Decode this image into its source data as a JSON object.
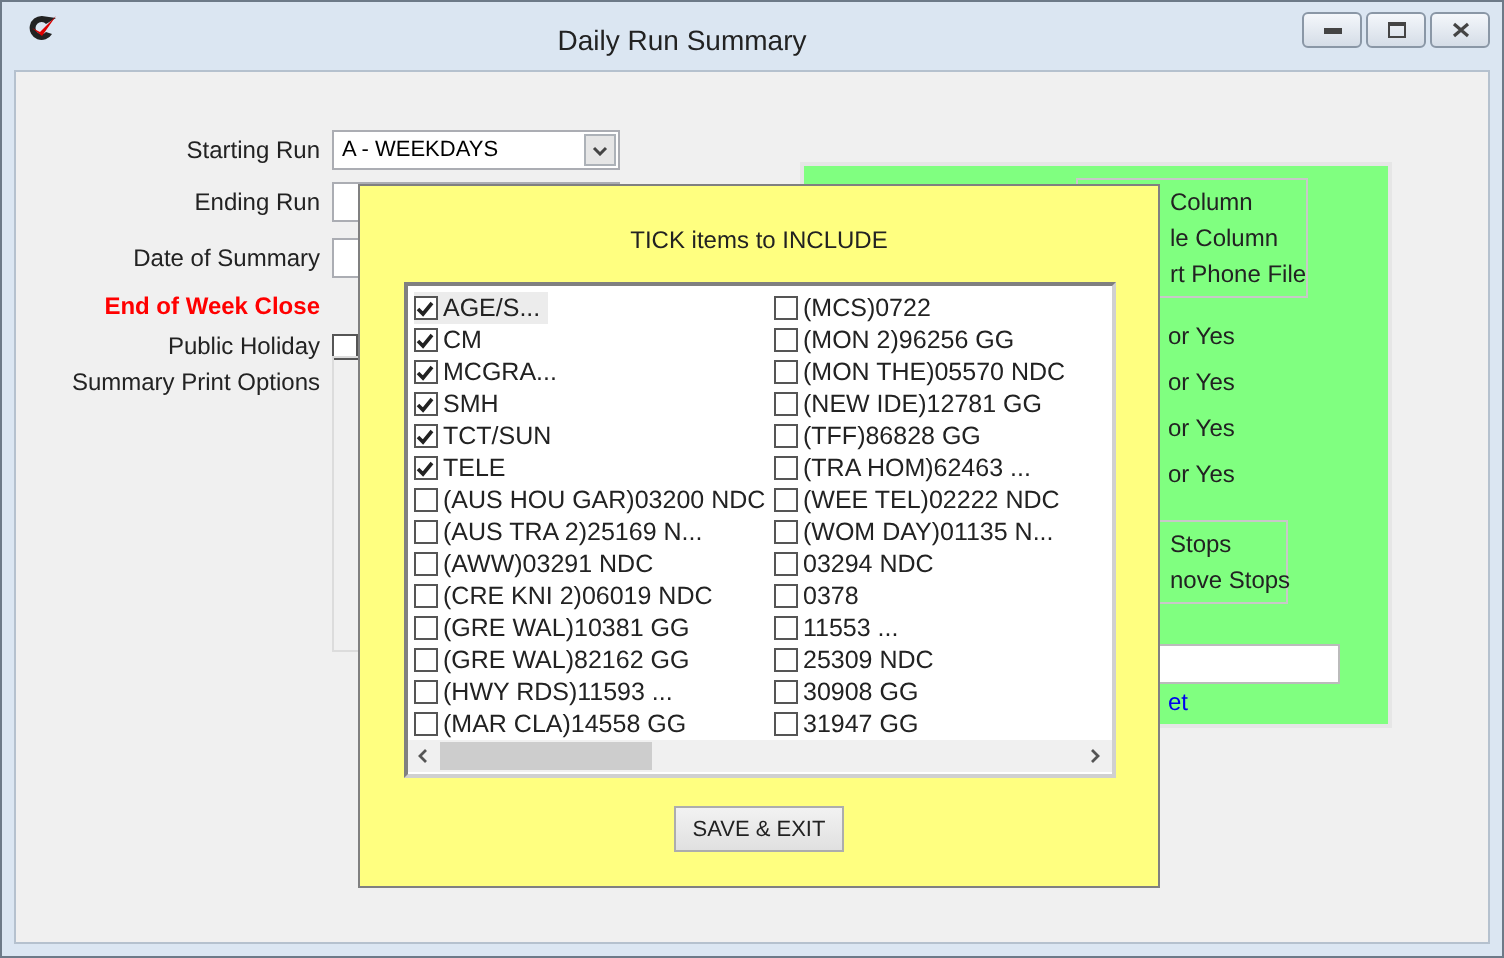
{
  "window": {
    "title": "Daily Run Summary"
  },
  "form": {
    "fields": [
      {
        "label": "Starting Run",
        "kind": "select",
        "value": "A  - WEEKDAYS"
      },
      {
        "label": "Ending Run",
        "kind": "select"
      },
      {
        "label": "Date of Summary",
        "kind": "text"
      },
      {
        "label": "End of Week Close",
        "kind": "warning"
      },
      {
        "label": "Public Holiday",
        "kind": "checkbox",
        "checked": false
      },
      {
        "label": "Summary Print Options",
        "kind": "panel"
      }
    ]
  },
  "options_panel": {
    "group_1": [
      "Column",
      "le Column",
      "rt Phone File"
    ],
    "toggles": [
      "or Yes",
      "or Yes",
      "or Yes",
      "or Yes"
    ],
    "group_2": [
      "Stops",
      "nove Stops"
    ],
    "link": "et"
  },
  "dialog": {
    "title": "TICK items to INCLUDE",
    "items": [
      {
        "label": "AGE/S...",
        "checked": true,
        "selected": true
      },
      {
        "label": "CM",
        "checked": true,
        "selected": false
      },
      {
        "label": "MCGRA...",
        "checked": true,
        "selected": false
      },
      {
        "label": "SMH",
        "checked": true,
        "selected": false
      },
      {
        "label": "TCT/SUN",
        "checked": true,
        "selected": false
      },
      {
        "label": "TELE",
        "checked": true,
        "selected": false
      },
      {
        "label": "(AUS HOU GAR)03200 NDC",
        "checked": false,
        "selected": false
      },
      {
        "label": "(AUS TRA 2)25169 N...",
        "checked": false,
        "selected": false
      },
      {
        "label": "(AWW)03291 NDC",
        "checked": false,
        "selected": false
      },
      {
        "label": "(CRE KNI 2)06019 NDC",
        "checked": false,
        "selected": false
      },
      {
        "label": "(GRE WAL)10381 GG",
        "checked": false,
        "selected": false
      },
      {
        "label": "(GRE WAL)82162 GG",
        "checked": false,
        "selected": false
      },
      {
        "label": "(HWY RDS)11593 ...",
        "checked": false,
        "selected": false
      },
      {
        "label": "(MAR CLA)14558 GG",
        "checked": false,
        "selected": false
      },
      {
        "label": "(MCS)0722",
        "checked": false,
        "selected": false
      },
      {
        "label": "(MON 2)96256 GG",
        "checked": false,
        "selected": false
      },
      {
        "label": "(MON THE)05570 NDC",
        "checked": false,
        "selected": false
      },
      {
        "label": "(NEW IDE)12781 GG",
        "checked": false,
        "selected": false
      },
      {
        "label": "(TFF)86828 GG",
        "checked": false,
        "selected": false
      },
      {
        "label": "(TRA HOM)62463 ...",
        "checked": false,
        "selected": false
      },
      {
        "label": "(WEE TEL)02222 NDC",
        "checked": false,
        "selected": false
      },
      {
        "label": "(WOM DAY)01135 N...",
        "checked": false,
        "selected": false
      },
      {
        "label": "03294 NDC",
        "checked": false,
        "selected": false
      },
      {
        "label": "0378",
        "checked": false,
        "selected": false
      },
      {
        "label": "11553 ...",
        "checked": false,
        "selected": false
      },
      {
        "label": "25309 NDC",
        "checked": false,
        "selected": false
      },
      {
        "label": "30908 GG",
        "checked": false,
        "selected": false
      },
      {
        "label": "31947 GG",
        "checked": false,
        "selected": false
      }
    ],
    "button": "SAVE & EXIT"
  }
}
